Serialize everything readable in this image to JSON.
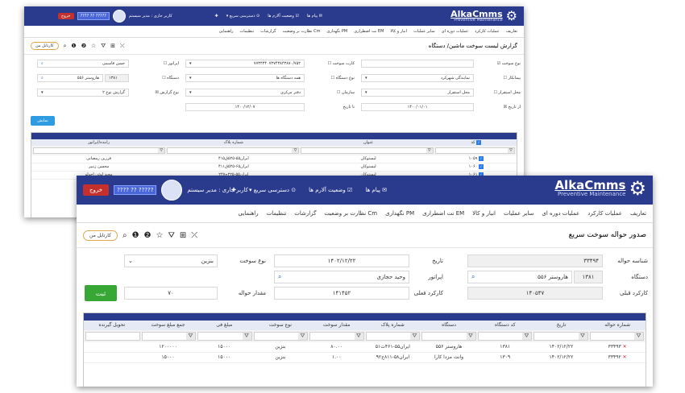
{
  "app": {
    "logo_main": "AlkaCmms",
    "logo_sub": "Preventive Maintenance",
    "gear_icon": "⚙"
  },
  "header": {
    "menu_items": [
      {
        "icon": "✉",
        "label": "پیام ها",
        "badge_color": "#4bd14b"
      },
      {
        "icon": "☑",
        "label": "وضعیت آلارم ها"
      },
      {
        "icon": "⊙",
        "label": "دسترسی سریع"
      }
    ],
    "pin_icon": "✚",
    "user_label": "کاربر جاری : مدیر سیستم",
    "user_label_short": "کاربر جاری : مدیر سیستم",
    "phone": "????? ?? ????",
    "exit_label": "خروج",
    "exit_label_short": "خروج"
  },
  "nav": {
    "items": [
      "تعاریف",
      "عملیات کارکرد",
      "عملیات دوره ای",
      "سایر عملیات",
      "انبار و کالا",
      "EM نت اضطراری",
      "PM نگهداری",
      "Cm نظارت بر وضعیت",
      "گزارشات",
      "تنظیمات",
      "راهنمایی"
    ]
  },
  "back": {
    "page_title": "گزارش لیست سوخت ماشین/ دستگاه",
    "card_label": "کارتابل من",
    "tool_icons": [
      "⌕",
      "❶",
      "❷",
      "☆",
      "⛛",
      "⊞",
      "⤫"
    ],
    "fields": {
      "fuel_type_check": "نوع سوخت",
      "fuel_type_value": "",
      "fuel_card_check": "کارت سوخت",
      "fuel_card_value": "۷۷۳۴۳۴۰۷۳۷۴۳۸۴۳۸۷۰/۷۵۲",
      "operator_check": "اپراتور",
      "operator_value": "حسن قاسمی",
      "contractor_check": "پیمانکار",
      "contractor_value": "نمایندگی شهرکرد",
      "device_type_check": "نوع دستگاه",
      "device_type_value": "همه دستگاه ها",
      "device_check": "دستگاه",
      "device_code": "۱۳۸۱",
      "device_value": "هاروستر ۵۵۶",
      "place_check": "محل استقرار",
      "place_value": "محل استقرار",
      "org_check": "سازمان",
      "org_value": "دفتر مرکزی",
      "report_type_check": "نوع گزارش",
      "report_type_value": "گزارش نوع ۲",
      "from_date_check": "از تاریخ",
      "from_date_value": "۱۴۰۰/۰۱/۰۱",
      "to_date_label": "تا تاریخ",
      "to_date_value": "۱۴۰۰/۱۲/۰۷",
      "show_button": "نمایش"
    },
    "grid": {
      "columns": [
        "کد",
        "عنوان",
        "شماره پلاک",
        "راننده/اپراتور"
      ],
      "rows": [
        [
          "۱۰۵۹",
          "لیستوکان",
          "ایران۵۵-۵۲۵ق۴۱۵",
          "فرزین رمضانی"
        ],
        [
          "۱۰۶۰",
          "لیستوکان",
          "ایران۶۵-۵۲۵ق۴۱۱",
          "محسن زنبیر"
        ],
        [
          "۱۰۶۱",
          "لیستوکان",
          "ایران۵۵-۲۲۵ج۲۴۷",
          "مجید لوئی اجولو"
        ]
      ]
    }
  },
  "front": {
    "page_title": "صدور حواله سوخت سریع",
    "card_label": "کارتابل من",
    "tool_icons": [
      "⌕",
      "❶",
      "❷",
      "☆",
      "⛛",
      "⊞",
      "⤫"
    ],
    "form": {
      "ref_label": "شناسه حواله",
      "ref_value": "۳۳۴۹۴",
      "date_label": "تاریخ",
      "date_value": "۱۴۰۲/۱۲/۲۲",
      "fuel_label": "نوع سوخت",
      "fuel_value": "بنزین",
      "device_label": "دستگاه",
      "device_code": "۱۳۸۱",
      "device_value": "هاروستر ۵۵۶",
      "operator_label": "اپراتور",
      "operator_value": "وحید حجازی",
      "prev_label": "کارکرد قبلی",
      "prev_value": "۱۴۰۵۴۷",
      "cur_label": "کارکرد فعلی",
      "cur_value": "۱۴۱۴۵۲",
      "amount_label": "مقدار حواله",
      "amount_value": "۷۰",
      "submit_label": "ثبت"
    },
    "grid": {
      "columns": [
        "شماره حواله",
        "تاریخ",
        "کد دستگاه",
        "دستگاه",
        "شماره پلاک",
        "مقدار سوخت",
        "نوع سوخت",
        "مبلغ فی",
        "جمع مبلغ سوخت",
        "تحویل گیرنده"
      ],
      "rows": [
        [
          "۳۳۴۹۳",
          "۱۴۰۲/۱۲/۲۲",
          "۱۳۸۱",
          "هاروستر ۵۵۶",
          "ایران۵۵-۴۶۱ت۵۱",
          "۸۰.۰۰",
          "بنزین",
          "۱۵۰۰۰",
          "۱۲۰۰۰۰۰",
          ""
        ],
        [
          "۳۳۴۹۲",
          "۱۴۰۲/۱۲/۲۲",
          "۱۳۰۹",
          "وانت مزدا کارا",
          "ایران۵۸-۸۱۱ج۹۲",
          "۱.۰۰",
          "بنزین",
          "۱۵۰۰۰",
          "۱۵۰۰۰",
          ""
        ]
      ]
    }
  }
}
